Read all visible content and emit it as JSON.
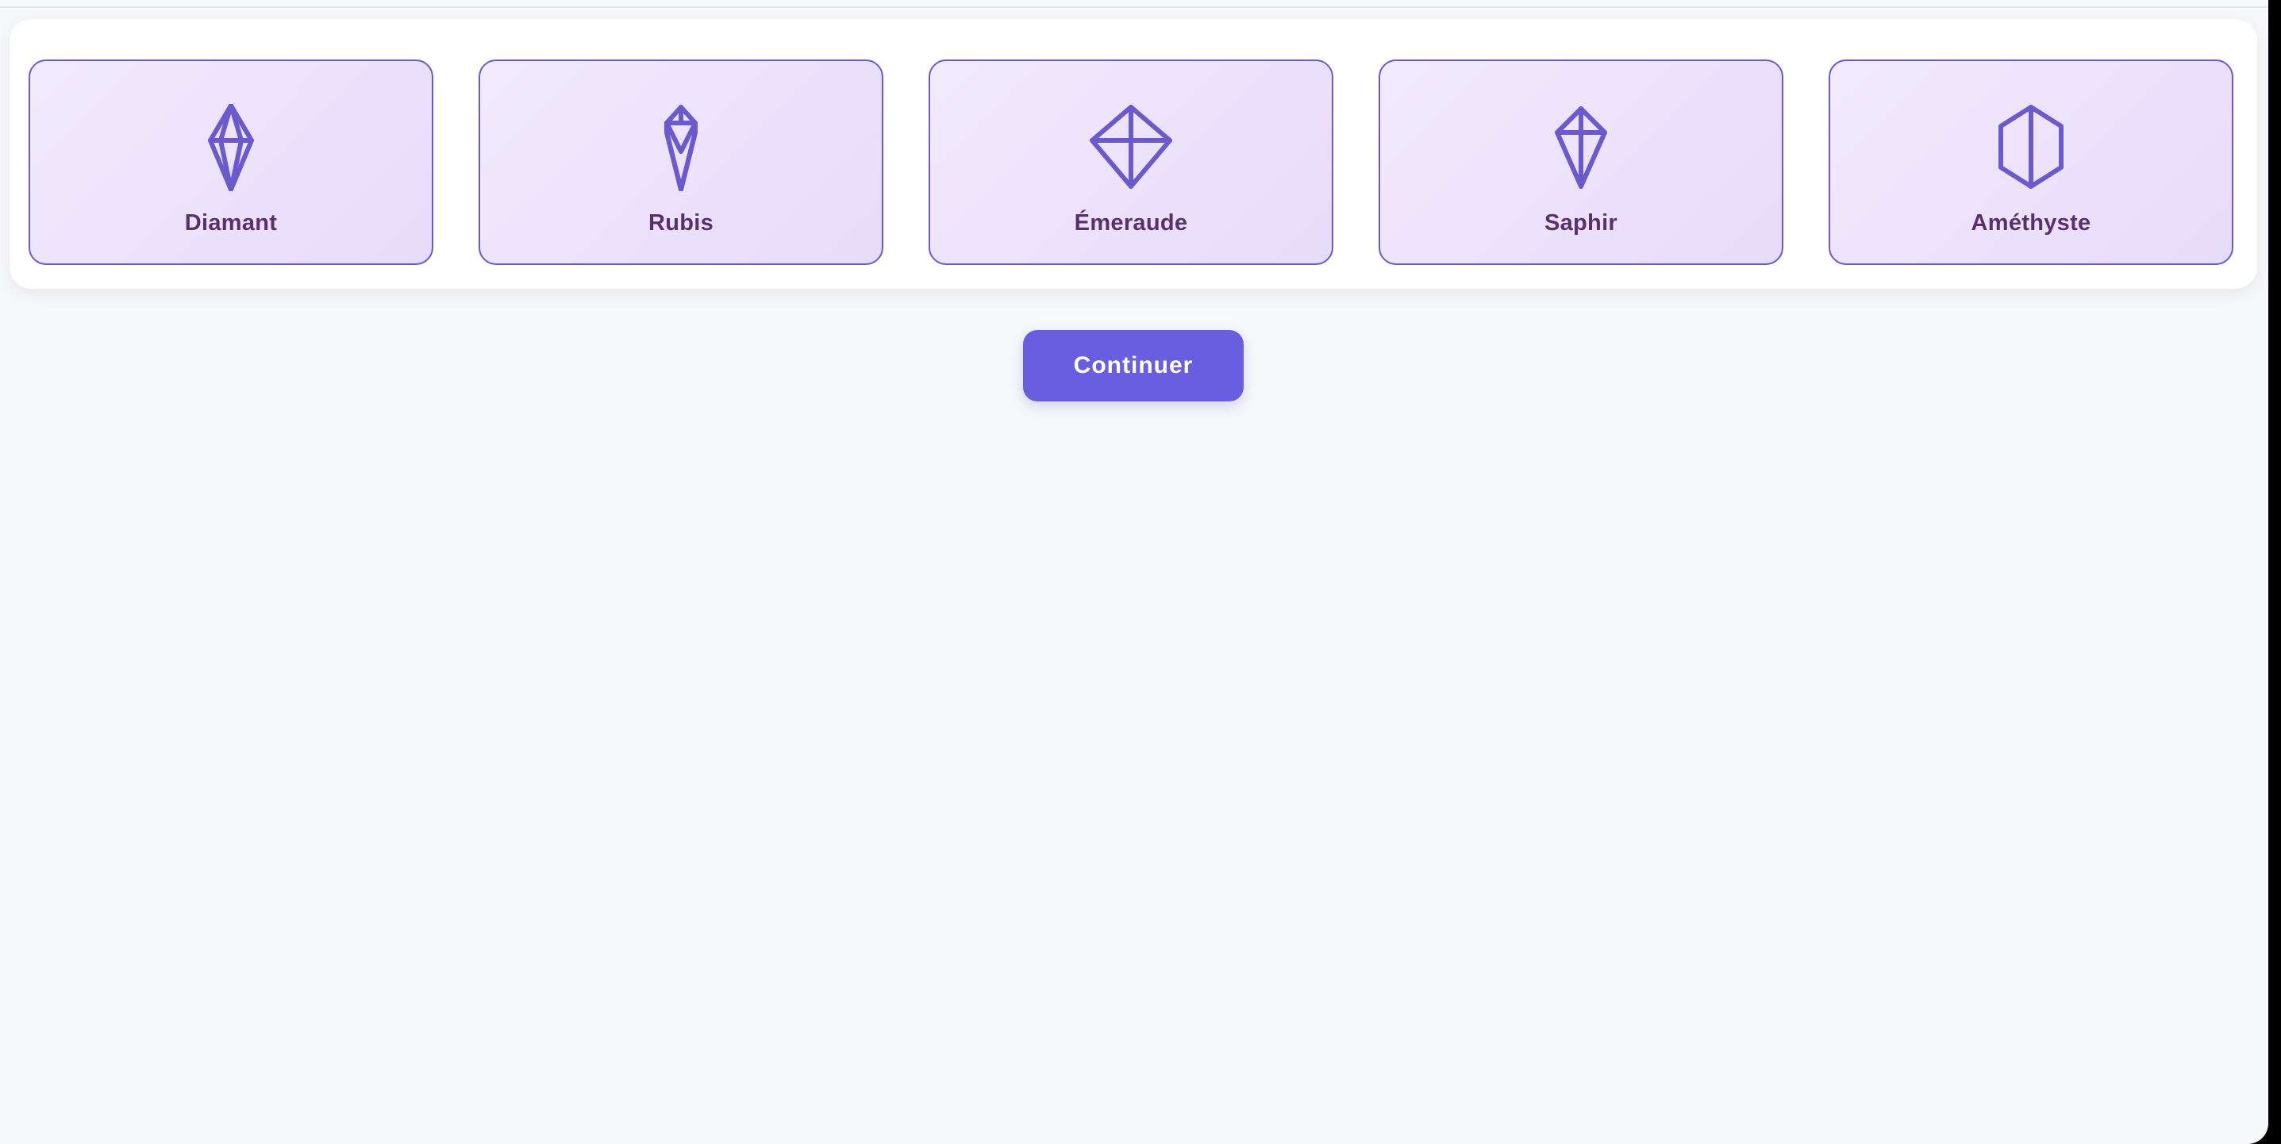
{
  "colors": {
    "accent": "#6a5acd",
    "card_bg_start": "#f2eafd",
    "card_bg_end": "#e7dbfb",
    "label_text": "#5a2f6e",
    "button_bg": "#6a5ee0",
    "page_bg": "#f7f8fa"
  },
  "gems": [
    {
      "label": "Diamant",
      "icon": "diamond-icon"
    },
    {
      "label": "Rubis",
      "icon": "ruby-icon"
    },
    {
      "label": "Émeraude",
      "icon": "emerald-icon"
    },
    {
      "label": "Saphir",
      "icon": "sapphire-icon"
    },
    {
      "label": "Améthyste",
      "icon": "amethyst-icon"
    }
  ],
  "actions": {
    "continue_label": "Continuer"
  }
}
